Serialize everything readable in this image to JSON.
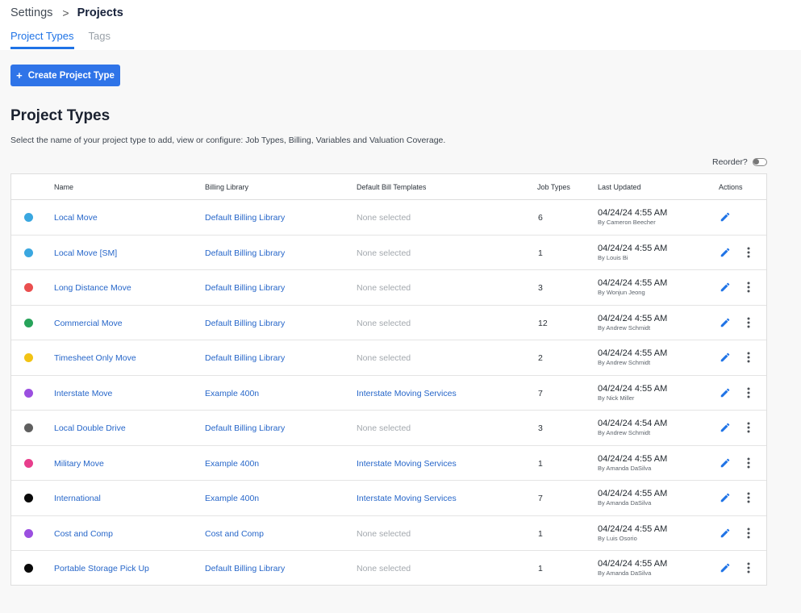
{
  "breadcrumb": {
    "parent": "Settings",
    "separator": ">",
    "current": "Projects"
  },
  "tabs": [
    {
      "label": "Project Types",
      "active": true
    },
    {
      "label": "Tags",
      "active": false
    }
  ],
  "create_button": {
    "icon": "+",
    "label": "Create Project Type"
  },
  "page": {
    "title": "Project Types",
    "subtitle": "Select the name of your project type to add, view or configure: Job Types, Billing, Variables and Valuation Coverage."
  },
  "reorder": {
    "label": "Reorder?",
    "enabled": false
  },
  "table": {
    "headers": [
      "Name",
      "Billing Library",
      "Default Bill Templates",
      "Job Types",
      "Last Updated",
      "Actions"
    ],
    "rows": [
      {
        "color": "#3aa7e0",
        "name": "Local Move",
        "billing_library": "Default Billing Library",
        "template": "None selected",
        "template_set": false,
        "job_types": "6",
        "updated": "04/24/24 4:55 AM",
        "by": "By Cameron Beecher",
        "has_more": false
      },
      {
        "color": "#3aa7e0",
        "name": "Local Move [SM]",
        "billing_library": "Default Billing Library",
        "template": "None selected",
        "template_set": false,
        "job_types": "1",
        "updated": "04/24/24 4:55 AM",
        "by": "By Louis Bi",
        "has_more": true
      },
      {
        "color": "#ea4f4f",
        "name": "Long Distance Move",
        "billing_library": "Default Billing Library",
        "template": "None selected",
        "template_set": false,
        "job_types": "3",
        "updated": "04/24/24 4:55 AM",
        "by": "By Wonjun Jeong",
        "has_more": true
      },
      {
        "color": "#27a35a",
        "name": "Commercial Move",
        "billing_library": "Default Billing Library",
        "template": "None selected",
        "template_set": false,
        "job_types": "12",
        "updated": "04/24/24 4:55 AM",
        "by": "By Andrew Schmidt",
        "has_more": true
      },
      {
        "color": "#f2c314",
        "name": "Timesheet Only Move",
        "billing_library": "Default Billing Library",
        "template": "None selected",
        "template_set": false,
        "job_types": "2",
        "updated": "04/24/24 4:55 AM",
        "by": "By Andrew Schmidt",
        "has_more": true
      },
      {
        "color": "#9b4fe0",
        "name": "Interstate Move",
        "billing_library": "Example 400n",
        "template": "Interstate Moving Services",
        "template_set": true,
        "job_types": "7",
        "updated": "04/24/24 4:55 AM",
        "by": "By Nick Miller",
        "has_more": true
      },
      {
        "color": "#5f5f5f",
        "name": "Local Double Drive",
        "billing_library": "Default Billing Library",
        "template": "None selected",
        "template_set": false,
        "job_types": "3",
        "updated": "04/24/24 4:54 AM",
        "by": "By Andrew Schmidt",
        "has_more": true
      },
      {
        "color": "#e83e8c",
        "name": "Military Move",
        "billing_library": "Example 400n",
        "template": "Interstate Moving Services",
        "template_set": true,
        "job_types": "1",
        "updated": "04/24/24 4:55 AM",
        "by": "By Amanda DaSilva",
        "has_more": true
      },
      {
        "color": "#0a0a0a",
        "name": "International",
        "billing_library": "Example 400n",
        "template": "Interstate Moving Services",
        "template_set": true,
        "job_types": "7",
        "updated": "04/24/24 4:55 AM",
        "by": "By Amanda DaSilva",
        "has_more": true
      },
      {
        "color": "#9b4fe0",
        "name": "Cost and Comp",
        "billing_library": "Cost and Comp",
        "template": "None selected",
        "template_set": false,
        "job_types": "1",
        "updated": "04/24/24 4:55 AM",
        "by": "By Luis Osorio",
        "has_more": true
      },
      {
        "color": "#0a0a0a",
        "name": "Portable Storage Pick Up",
        "billing_library": "Default Billing Library",
        "template": "None selected",
        "template_set": false,
        "job_types": "1",
        "updated": "04/24/24 4:55 AM",
        "by": "By Amanda DaSilva",
        "has_more": true
      }
    ]
  },
  "icons": {
    "edit": "pencil-icon",
    "more": "more-vertical-icon",
    "accent": "#1f73e6"
  }
}
